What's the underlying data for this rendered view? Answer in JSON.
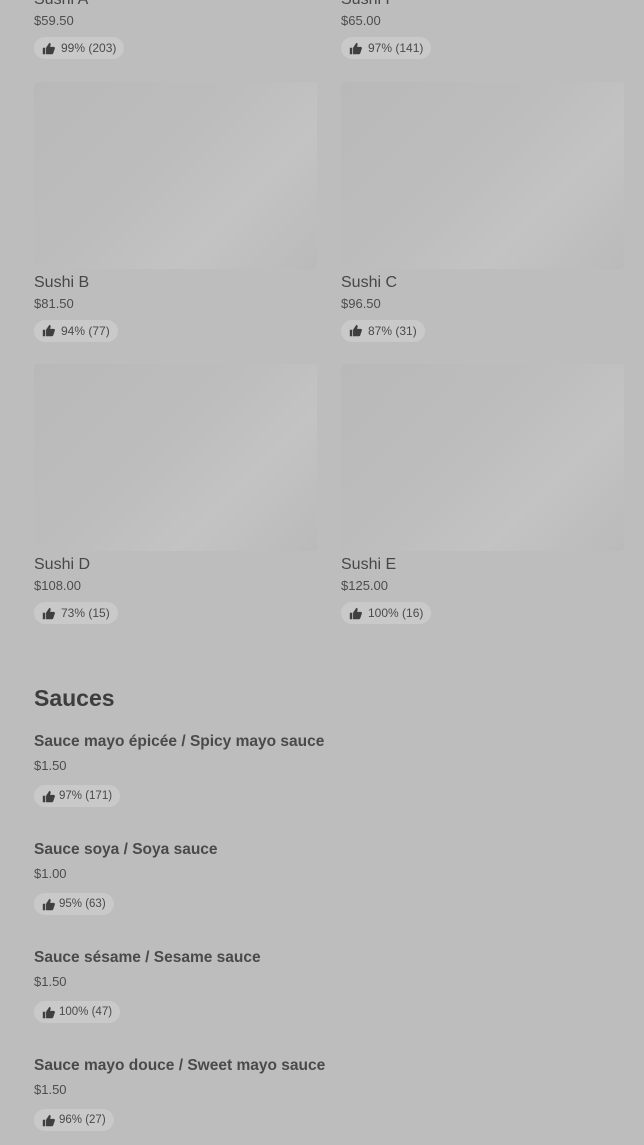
{
  "products": [
    {
      "name": "Sushi A",
      "price": "$59.50",
      "rating": "99% (203)"
    },
    {
      "name": "Sushi F",
      "price": "$65.00",
      "rating": "97% (141)"
    },
    {
      "name": "Sushi B",
      "price": "$81.50",
      "rating": "94% (77)"
    },
    {
      "name": "Sushi C",
      "price": "$96.50",
      "rating": "87% (31)"
    },
    {
      "name": "Sushi D",
      "price": "$108.00",
      "rating": "73% (15)"
    },
    {
      "name": "Sushi E",
      "price": "$125.00",
      "rating": "100% (16)"
    }
  ],
  "sauces_section": {
    "title": "Sauces",
    "items": [
      {
        "name": "Sauce mayo épicée / Spicy mayo sauce",
        "price": "$1.50",
        "rating": "97% (171)"
      },
      {
        "name": "Sauce soya / Soya sauce",
        "price": "$1.00",
        "rating": "95% (63)"
      },
      {
        "name": "Sauce sésame / Sesame sauce",
        "price": "$1.50",
        "rating": "100% (47)"
      },
      {
        "name": "Sauce mayo douce / Sweet mayo sauce",
        "price": "$1.50",
        "rating": "96% (27)"
      }
    ]
  },
  "icons": {
    "rating": "thumbs-up-icon"
  }
}
